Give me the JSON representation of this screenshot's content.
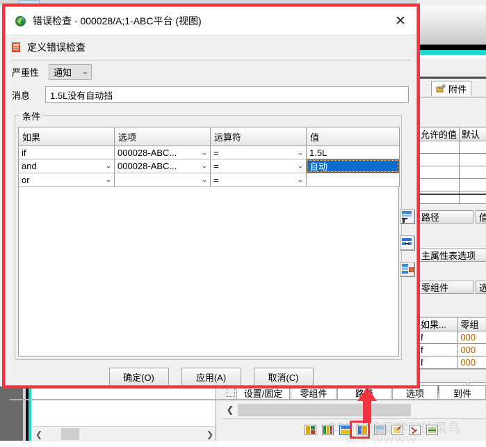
{
  "dialog": {
    "title": "错误检查 - 000028/A;1-ABC平台 (视图)",
    "title_icon": "app-icon",
    "close_label": "✕",
    "section_header": "定义错误检查",
    "section_icon": "error-check-icon",
    "severity_label": "严重性",
    "severity_value": "通知",
    "message_label": "消息",
    "message_value": "1.5L没有自动挡",
    "conditions_legend": "条件",
    "columns": [
      "如果",
      "选项",
      "运算符",
      "值"
    ],
    "rows": [
      {
        "if": "if",
        "if_has_dropdown": false,
        "option": "000028-ABC...",
        "operator": "=",
        "value": "1.5L",
        "value_selected": false
      },
      {
        "if": "and",
        "if_has_dropdown": true,
        "option": "000028-ABC...",
        "operator": "=",
        "value": "自动",
        "value_selected": true
      },
      {
        "if": "or",
        "if_has_dropdown": true,
        "option": "",
        "operator": "=",
        "value": "",
        "value_selected": false
      }
    ],
    "side_buttons": [
      "insert-row-above-button",
      "insert-row-button",
      "delete-row-button"
    ],
    "buttons": [
      {
        "label": "确定(O)",
        "name": "ok-button"
      },
      {
        "label": "应用(A)",
        "name": "apply-button"
      },
      {
        "label": "取消(C)",
        "name": "cancel-button"
      }
    ]
  },
  "background": {
    "attachment_tab": "附件",
    "attachment_tab_icon": "paperclip-icon",
    "table1_headers": [
      "允许的值",
      "默认"
    ],
    "table1_rows": 5,
    "group_path": "路径",
    "group_valuetype": "值类",
    "main_attr_tab": "主属性表选项",
    "group_parts": "零组件",
    "group_options": "选项",
    "table2_headers": [
      "如果...",
      "零组"
    ],
    "table2_rows": [
      {
        "c1": "f",
        "c2": "000"
      },
      {
        "c1": "f",
        "c2": "000"
      },
      {
        "c1": "f",
        "c2": "000"
      }
    ],
    "group_options2": "选项",
    "group_to": "到件",
    "bottom_tabs": [
      {
        "label": "设置/固定",
        "name": "tab-settings-fixed"
      },
      {
        "label": "零组件",
        "name": "tab-parts"
      },
      {
        "label": "路径",
        "name": "tab-path"
      },
      {
        "label": "选项",
        "name": "tab-options"
      },
      {
        "label": "到件",
        "name": "tab-to-part"
      }
    ],
    "nav_prev": "❮",
    "scroll_prev": "❮",
    "scroll_next": "❯",
    "watermark_line1": "CSDN @爱学习的菜鸟",
    "watermark_line2": "菜鸟 WWWW"
  },
  "colors": {
    "accent_red": "#f5333f",
    "selection_blue": "#0a6ed1",
    "cyan_band": "#24d6d0"
  }
}
